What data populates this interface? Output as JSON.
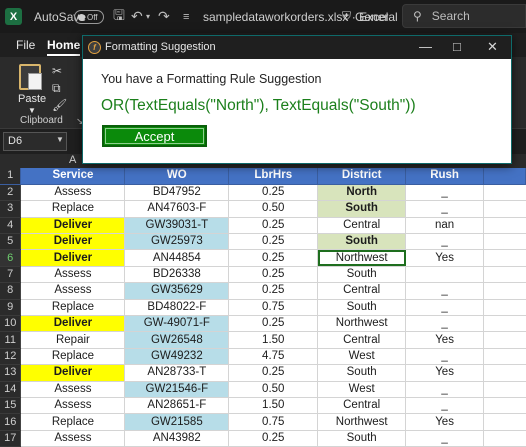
{
  "titlebar": {
    "autosave_label": "AutoSave",
    "autosave_state": "Off",
    "filename": "sampledataworkorders.xlsx",
    "separator": "·",
    "app_name": "Excel",
    "sensitivity": "General",
    "search_label": "Search"
  },
  "ribbon": {
    "tabs": [
      "File",
      "Home"
    ],
    "paste_label": "Paste",
    "clipboard_label": "Clipboard"
  },
  "formula_bar": {
    "name_box": "D6"
  },
  "columns": {
    "a": "A"
  },
  "dialog": {
    "title": "Formatting Suggestion",
    "message": "You have a Formatting Rule Suggestion",
    "rule": "OR(TextEquals(\"North\"), TextEquals(\"South\"))",
    "accept_label": "Accept"
  },
  "sheet": {
    "headers": [
      "Service",
      "WO",
      "LbrHrs",
      "District",
      "Rush"
    ],
    "rows": [
      {
        "n": "2",
        "service": "Assess",
        "wo": "BD47952",
        "hrs": "0.25",
        "district": "North",
        "rush": "_"
      },
      {
        "n": "3",
        "service": "Replace",
        "wo": "AN47603-F",
        "hrs": "0.50",
        "district": "South",
        "rush": "_"
      },
      {
        "n": "4",
        "service": "Deliver",
        "wo": "GW39031-T",
        "hrs": "0.25",
        "district": "Central",
        "rush": "nan"
      },
      {
        "n": "5",
        "service": "Deliver",
        "wo": "GW25973",
        "hrs": "0.25",
        "district": "South",
        "rush": "_"
      },
      {
        "n": "6",
        "service": "Deliver",
        "wo": "AN44854",
        "hrs": "0.25",
        "district": "Northwest",
        "rush": "Yes"
      },
      {
        "n": "7",
        "service": "Assess",
        "wo": "BD26338",
        "hrs": "0.25",
        "district": "South",
        "rush": ""
      },
      {
        "n": "8",
        "service": "Assess",
        "wo": "GW35629",
        "hrs": "0.25",
        "district": "Central",
        "rush": "_"
      },
      {
        "n": "9",
        "service": "Replace",
        "wo": "BD48022-F",
        "hrs": "0.75",
        "district": "South",
        "rush": "_"
      },
      {
        "n": "10",
        "service": "Deliver",
        "wo": "GW-49071-F",
        "hrs": "0.25",
        "district": "Northwest",
        "rush": "_"
      },
      {
        "n": "11",
        "service": "Repair",
        "wo": "GW26548",
        "hrs": "1.50",
        "district": "Central",
        "rush": "Yes"
      },
      {
        "n": "12",
        "service": "Replace",
        "wo": "GW49232",
        "hrs": "4.75",
        "district": "West",
        "rush": "_"
      },
      {
        "n": "13",
        "service": "Deliver",
        "wo": "AN28733-T",
        "hrs": "0.25",
        "district": "South",
        "rush": "Yes"
      },
      {
        "n": "14",
        "service": "Assess",
        "wo": "GW21546-F",
        "hrs": "0.50",
        "district": "West",
        "rush": "_"
      },
      {
        "n": "15",
        "service": "Assess",
        "wo": "AN28651-F",
        "hrs": "1.50",
        "district": "Central",
        "rush": "_"
      },
      {
        "n": "16",
        "service": "Replace",
        "wo": "GW21585",
        "hrs": "0.75",
        "district": "Northwest",
        "rush": "Yes"
      },
      {
        "n": "17",
        "service": "Assess",
        "wo": "AN43982",
        "hrs": "0.25",
        "district": "South",
        "rush": "_"
      }
    ]
  },
  "colors": {
    "header_blue": "#4472c4",
    "deliver_yellow": "#ffff00",
    "wo_highlight": "#b7dde8",
    "north_south_green": "#d8e4bc",
    "accept_green": "#0b8a0b",
    "rule_text_green": "#1b7f1b"
  }
}
